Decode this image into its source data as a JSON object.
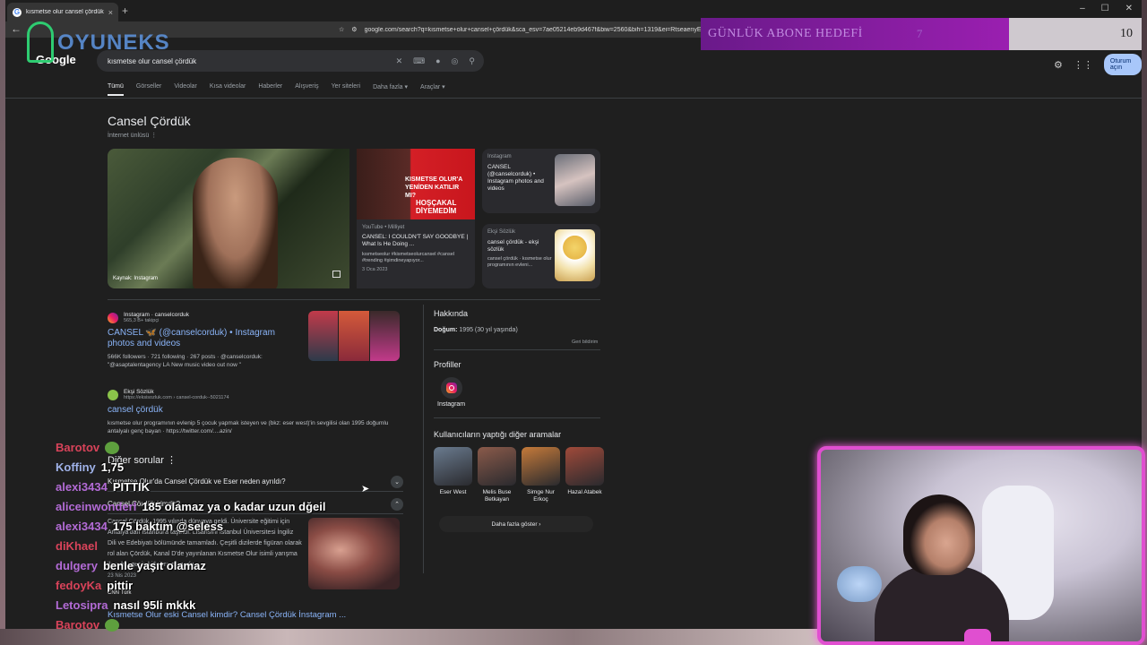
{
  "browser": {
    "tab_title": "kısmetse olur cansel çördük - Go",
    "url": "google.com/search?q=kısmetse+olur+cansel+çördük&sca_esv=7ae05214eb9d467f&biw=2560&bih=1319&ei=RtseaenyE76C",
    "close": "×",
    "new_tab": "+",
    "back": "←",
    "min": "–",
    "max": "☐",
    "win_close": "✕"
  },
  "google": {
    "logo": "Google",
    "query": "kısmetse olur cansel çördük",
    "sign_in": "Oturum açın",
    "tabs": [
      "Tümü",
      "Görseller",
      "Videolar",
      "Kısa videolar",
      "Haberler",
      "Alışveriş",
      "Yer siteleri",
      "Daha fazla ▾",
      "Araçlar ▾"
    ]
  },
  "knowledge": {
    "title": "Cansel Çördük",
    "subtitle": "İnternet ünlüsü  ⋮",
    "main_photo_source": "Kaynak: Instagram",
    "yt_card": {
      "thumb_text": "KISMETSE OLUR'A YENİDEN KATILIR MI?",
      "thumb_text2": "HOŞÇAKAL DİYEMEDİM",
      "source": "YouTube • Milliyet",
      "title": "CANSEL: I COULDN'T SAY GOODBYE | What Is He Doing ...",
      "desc": "kısmetseolur #kismetseolurcansel #cansel #trending #şimdineyapıyor...",
      "date": "3 Oca 2023"
    },
    "ig_card": {
      "source": "Instagram",
      "title": "CANSEL (@canselcorduk) • Instagram photos and videos"
    },
    "eksi_card": {
      "source": "Ekşi Sözlük",
      "title": "cansel çördük - ekşi sözlük",
      "desc": "cansel çördük · kısmetse olur programının evleni..."
    }
  },
  "results": [
    {
      "source": "Instagram · canselcorduk",
      "url": "565,3 B+ takipçi",
      "title": "CANSEL 🦋 (@canselcorduk) • Instagram photos and videos",
      "snippet": "566K followers · 721 following · 267 posts · @canselcorduk: \"@asaptalentagency LA New music video out now \""
    },
    {
      "source": "Ekşi Sözlük",
      "url": "https://eksisozluk.com › cansel-corduk--5021174",
      "title": "cansel çördük",
      "snippet": "kısmetse olur programının evlenip 5 çocuk yapmak isteyen ve (bkz: eser west)'in sevgilisi olan 1995 doğumlu antalyalı genç bayan · https://twitter.com/....azin/"
    }
  ],
  "questions": {
    "title": "Diğer sorular  ⋮",
    "items": [
      "Kısmetse Olur'da Cansel Çördük ve Eser neden ayrıldı?",
      "Cansel Çördük kimdir?"
    ],
    "expand": "⌄",
    "collapse": "⌃",
    "answer": "Cansel Çördük, 1995 yılında dünyaya geldi. Üniversite eğitimi için Antalya'dan İstanbul'a taşındı. Lisansını İstanbul Üniversitesi İngiliz Dili ve Edebiyatı bölümünde tamamladı. Çeşitli dizilerde figüran olarak rol alan Çördük, Kanal D'de yayınlanan Kısmetse Olur isimli yarışma ile adını geniş kitlelere duyurdu.",
    "answer_date": "23 Nis 2023",
    "answer_source": "CNN Türk",
    "last_link": "Kısmetse Olur eski Cansel kimdir? Cansel Çördük İnstagram ..."
  },
  "right_panel": {
    "about": "Hakkında",
    "born_label": "Doğum:",
    "born_value": "1995 (30 yıl yaşında)",
    "feedback": "Geri bildirim",
    "profiles": "Profiller",
    "profile_ig": "Instagram",
    "people_title": "Kullanıcıların yaptığı diğer aramalar",
    "people": [
      {
        "name": "Eser West",
        "color": "#6a7b8f"
      },
      {
        "name": "Melis Buse Betkayan",
        "color": "#8a5a4a"
      },
      {
        "name": "Simge Nur Erkoç",
        "color": "#c57a3a"
      },
      {
        "name": "Hazal Atabek",
        "color": "#a04a3a"
      }
    ],
    "more": "Daha fazla göster  ›"
  },
  "overlay": {
    "logo_text": "OYUNEKS",
    "goal_label": "GÜNLÜK ABONE HEDEFİ",
    "goal_current": "7",
    "goal_target": "10",
    "goal_progress_percent": 70
  },
  "chat": [
    {
      "user": "Barotov",
      "color": "#d9435a",
      "msg": "",
      "emote": true
    },
    {
      "user": "Koffiny",
      "color": "#9fb2e8",
      "msg": "1,75",
      "emote": false
    },
    {
      "user": "alexi3434",
      "color": "#b36bd6",
      "msg": "PITTIK",
      "emote": false
    },
    {
      "user": "aliceinwonderl",
      "color": "#b36bd6",
      "msg": "185 olamaz ya o kadar uzun dğeil",
      "emote": false
    },
    {
      "user": "alexi3434",
      "color": "#b36bd6",
      "msg": "175 baktım @seless",
      "emote": false
    },
    {
      "user": "diKhael",
      "color": "#d9435a",
      "msg": "",
      "emote": false
    },
    {
      "user": "dulgery",
      "color": "#b36bd6",
      "msg": "benle yaşıt olamaz",
      "emote": false
    },
    {
      "user": "fedoyKa",
      "color": "#d9435a",
      "msg": "pittir",
      "emote": false
    },
    {
      "user": "Letosipra",
      "color": "#b36bd6",
      "msg": "nasıl 95li mkkk",
      "emote": false
    },
    {
      "user": "Barotov",
      "color": "#d9435a",
      "msg": "",
      "emote": true
    }
  ]
}
